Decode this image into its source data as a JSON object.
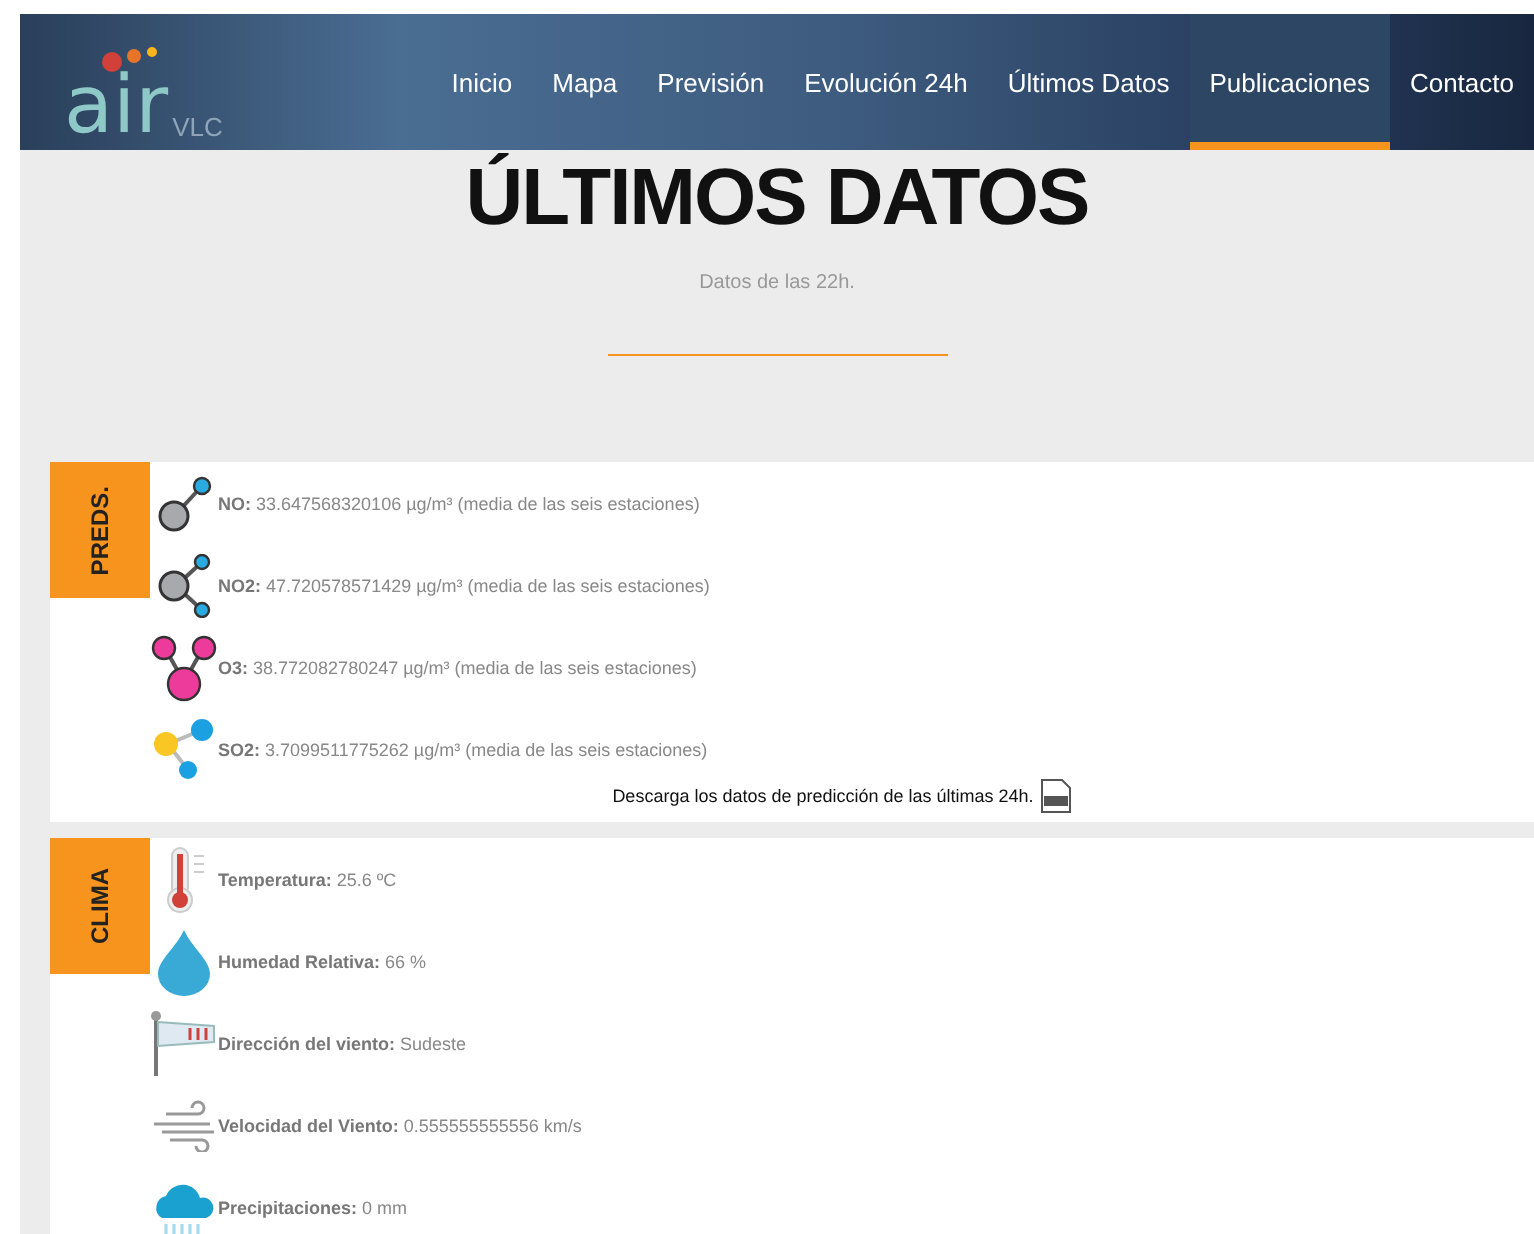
{
  "logo": {
    "main": "air",
    "sub": "VLC"
  },
  "nav": [
    {
      "label": "Inicio",
      "selected": false
    },
    {
      "label": "Mapa",
      "selected": false
    },
    {
      "label": "Previsión",
      "selected": false
    },
    {
      "label": "Evolución 24h",
      "selected": false
    },
    {
      "label": "Últimos Datos",
      "selected": false
    },
    {
      "label": "Publicaciones",
      "selected": true
    },
    {
      "label": "Contacto",
      "selected": false
    }
  ],
  "title": "ÚLTIMOS DATOS",
  "subtitle": "Datos de las 22h.",
  "sections": [
    {
      "label": "PREDS.",
      "items": [
        {
          "kind": "no",
          "text": "**NO:** 33.647568320106 µg/m³ (media de las seis estaciones)"
        },
        {
          "kind": "no2",
          "text": "**NO2:** 47.720578571429 µg/m³ (media de las seis estaciones)"
        },
        {
          "kind": "o3",
          "text": "**O3:** 38.772082780247 µg/m³ (media de las seis estaciones)"
        },
        {
          "kind": "so2",
          "text": "**SO2:** 3.7099511775262 µg/m³ (media de las seis estaciones)"
        }
      ],
      "download": "Descarga los datos de predicción de las últimas 24h."
    },
    {
      "label": "CLIMA",
      "items": [
        {
          "kind": "temperature",
          "text": "**Temperatura:** 25.6 ºC"
        },
        {
          "kind": "humidity",
          "text": "**Humedad Relativa:** 66 %"
        },
        {
          "kind": "wind_direction",
          "text": "**Dirección del viento:** Sudeste"
        },
        {
          "kind": "wind_speed",
          "text": "**Velocidad del Viento:** 0.555555555556 km/s"
        },
        {
          "kind": "rain",
          "text": "**Precipitaciones:** 0 mm"
        }
      ]
    }
  ]
}
